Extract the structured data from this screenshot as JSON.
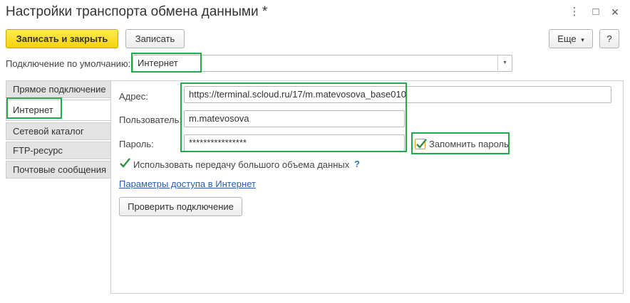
{
  "window": {
    "title": "Настройки транспорта обмена данными *",
    "more_icon": "⋮",
    "maximize_icon": "□",
    "close_icon": "×"
  },
  "toolbar": {
    "save_close_label": "Записать и закрыть",
    "save_label": "Записать",
    "more_label": "Еще",
    "more_arrow": "▾",
    "help_label": "?"
  },
  "connection_default": {
    "label": "Подключение по умолчанию:",
    "value": "Интернет",
    "dropdown_icon": "▾"
  },
  "tabs": [
    {
      "label": "Прямое подключение"
    },
    {
      "label": "Интернет"
    },
    {
      "label": "Сетевой каталог"
    },
    {
      "label": "FTP-ресурс"
    },
    {
      "label": "Почтовые сообщения"
    }
  ],
  "form": {
    "address_label": "Адрес:",
    "address_value": "https://terminal.scloud.ru/17/m.matevosova_base010",
    "user_label": "Пользователь:",
    "user_value": "m.matevosova",
    "password_label": "Пароль:",
    "password_value": "****************",
    "remember_password_label": "Запомнить пароль",
    "remember_password_checked": true,
    "large_transfer_label": "Использовать передачу большого объема данных",
    "large_transfer_checked": true,
    "help_mark": "?",
    "internet_params_link": "Параметры доступа в Интернет",
    "check_connection_label": "Проверить подключение"
  },
  "colors": {
    "highlight": "#1faa4b",
    "primary_button": "#f5d20a",
    "link": "#2a5db0",
    "check": "#2f8f3a"
  }
}
